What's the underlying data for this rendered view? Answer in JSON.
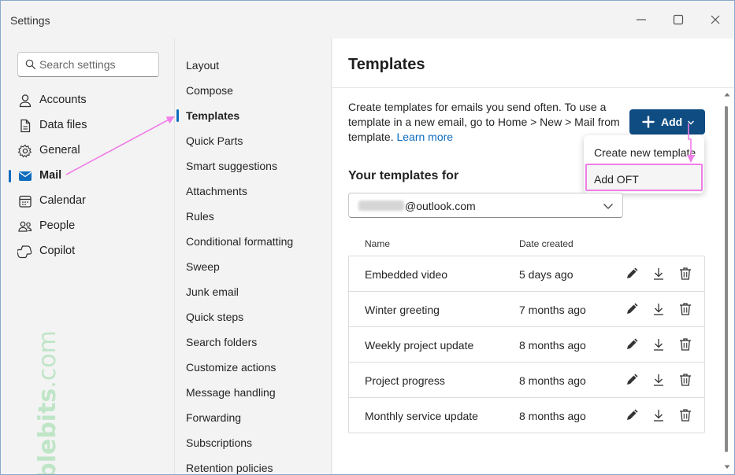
{
  "window": {
    "title": "Settings",
    "minimize_icon": "minimize-icon",
    "maximize_icon": "maximize-icon",
    "close_icon": "close-icon"
  },
  "search": {
    "placeholder": "Search settings"
  },
  "sidebar": {
    "items": [
      {
        "label": "Accounts",
        "icon": "person-icon"
      },
      {
        "label": "Data files",
        "icon": "document-icon"
      },
      {
        "label": "General",
        "icon": "gear-icon"
      },
      {
        "label": "Mail",
        "icon": "mail-icon",
        "active": true
      },
      {
        "label": "Calendar",
        "icon": "calendar-icon"
      },
      {
        "label": "People",
        "icon": "people-icon"
      },
      {
        "label": "Copilot",
        "icon": "copilot-icon"
      }
    ]
  },
  "watermark": {
    "text_bold": "Ablebits",
    "text_light": ".com"
  },
  "subnav": {
    "items": [
      {
        "label": "Layout"
      },
      {
        "label": "Compose"
      },
      {
        "label": "Templates",
        "active": true
      },
      {
        "label": "Quick Parts"
      },
      {
        "label": "Smart suggestions"
      },
      {
        "label": "Attachments"
      },
      {
        "label": "Rules"
      },
      {
        "label": "Conditional formatting"
      },
      {
        "label": "Sweep"
      },
      {
        "label": "Junk email"
      },
      {
        "label": "Quick steps"
      },
      {
        "label": "Search folders"
      },
      {
        "label": "Customize actions"
      },
      {
        "label": "Message handling"
      },
      {
        "label": "Forwarding"
      },
      {
        "label": "Subscriptions"
      },
      {
        "label": "Retention policies"
      }
    ]
  },
  "main": {
    "title": "Templates",
    "description": "Create templates for emails you send often. To use a template in a new email, go to Home > New > Mail from template.",
    "learn_more": "Learn more",
    "add_button": "Add",
    "add_menu": [
      {
        "label": "Create new template"
      },
      {
        "label": "Add OFT"
      }
    ],
    "templates_heading": "Your templates for",
    "account_suffix": "@outlook.com",
    "columns": {
      "name": "Name",
      "date": "Date created"
    },
    "rows": [
      {
        "name": "Embedded video",
        "date": "5 days ago"
      },
      {
        "name": "Winter greeting",
        "date": "7 months ago"
      },
      {
        "name": "Weekly project update",
        "date": "8 months ago"
      },
      {
        "name": "Project progress",
        "date": "8 months ago"
      },
      {
        "name": "Monthly service update",
        "date": "8 months ago"
      }
    ]
  },
  "colors": {
    "accent": "#0f6cbd",
    "add_button_bg": "#0f4c81",
    "annotation": "#f07ee8",
    "watermark": "#bfe5c7"
  }
}
